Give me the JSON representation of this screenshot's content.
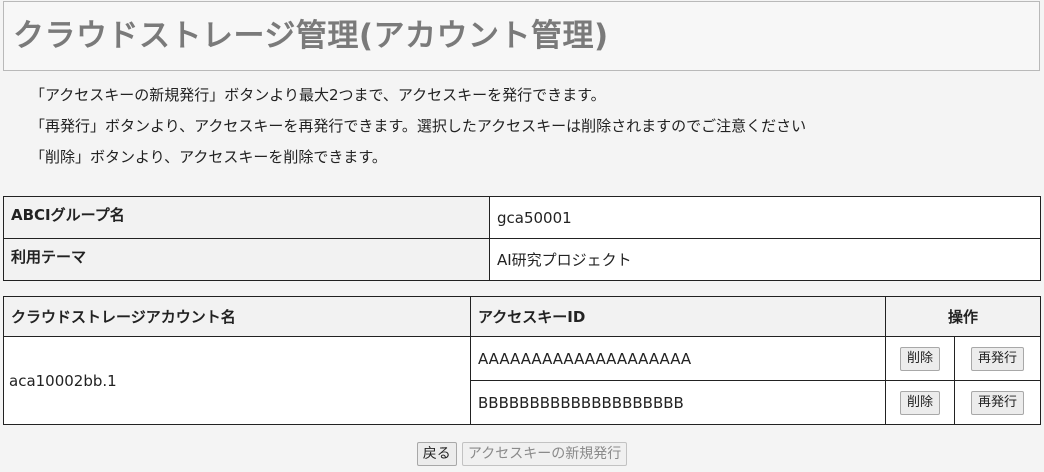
{
  "page": {
    "title": "クラウドストレージ管理(アカウント管理)"
  },
  "notes": [
    "「アクセスキーの新規発行」ボタンより最大2つまで、アクセスキーを発行できます。",
    "「再発行」ボタンより、アクセスキーを再発行できます。選択したアクセスキーは削除されますのでご注意ください",
    "「削除」ボタンより、アクセスキーを削除できます。"
  ],
  "info": {
    "group_label": "ABCIグループ名",
    "group_value": "gca50001",
    "theme_label": "利用テーマ",
    "theme_value": "AI研究プロジェクト"
  },
  "accounts": {
    "headers": {
      "account": "クラウドストレージアカウント名",
      "key_id": "アクセスキーID",
      "ops": "操作"
    },
    "account_name": "aca10002bb.1",
    "keys": [
      {
        "id": "AAAAAAAAAAAAAAAAAAAA",
        "delete_label": "削除",
        "reissue_label": "再発行"
      },
      {
        "id": "BBBBBBBBBBBBBBBBBBBB",
        "delete_label": "削除",
        "reissue_label": "再発行"
      }
    ]
  },
  "footer": {
    "back_label": "戻る",
    "new_key_label": "アクセスキーの新規発行"
  }
}
